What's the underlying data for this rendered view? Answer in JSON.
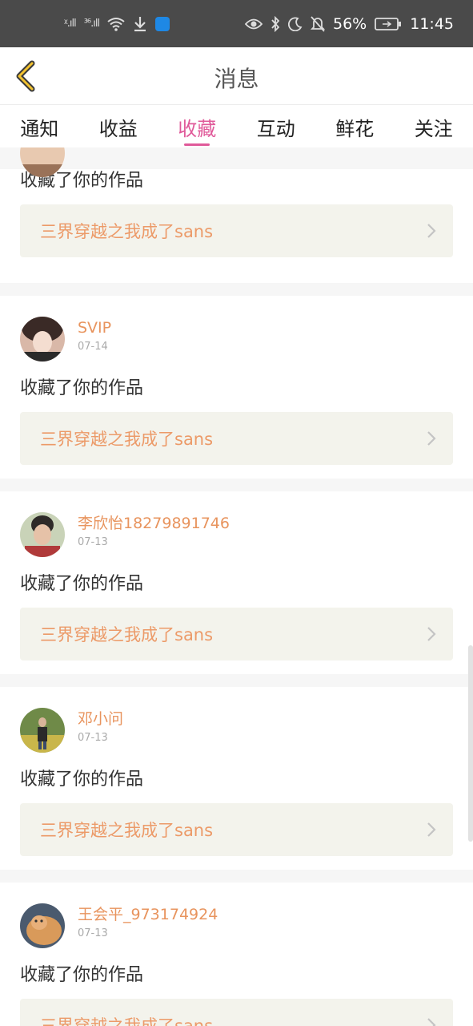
{
  "status": {
    "signal1": "ᵡ.ıll",
    "signal2": "³⁶.ıll",
    "battery_pct": "56%",
    "time": "11:45"
  },
  "header": {
    "title": "消息"
  },
  "tabs": [
    "通知",
    "收益",
    "收藏",
    "互动",
    "鲜花",
    "关注"
  ],
  "active_tab": "收藏",
  "top_item": {
    "action": "收藏了你的作品",
    "work": "三界穿越之我成了sans"
  },
  "items": [
    {
      "name": "SVIP",
      "date": "07-14",
      "action": "收藏了你的作品",
      "work": "三界穿越之我成了sans"
    },
    {
      "name": "李欣怡18279891746",
      "date": "07-13",
      "action": "收藏了你的作品",
      "work": "三界穿越之我成了sans"
    },
    {
      "name": "邓小问",
      "date": "07-13",
      "action": "收藏了你的作品",
      "work": "三界穿越之我成了sans"
    },
    {
      "name": "王会平_973174924",
      "date": "07-13",
      "action": "收藏了你的作品",
      "work": "三界穿越之我成了sans"
    }
  ],
  "colors": {
    "accent": "#e05a9a",
    "username": "#e8945e",
    "work_bg": "#f3f3ec",
    "work_text": "#ec9a68"
  },
  "icons": [
    "back-chevron-icon",
    "eye-icon",
    "bluetooth-icon",
    "moon-icon",
    "bell-off-icon",
    "battery-icon",
    "wifi-icon",
    "download-icon",
    "shield-icon",
    "chevron-right-icon"
  ]
}
